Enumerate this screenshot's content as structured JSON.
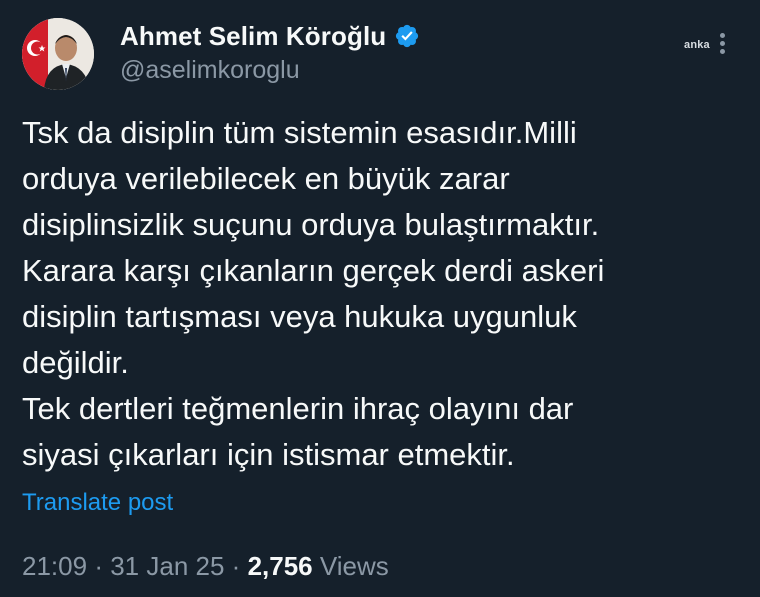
{
  "author": {
    "display_name": "Ahmet Selim Köroğlu",
    "handle": "@aselimkoroglu",
    "verified_icon": "verified-badge-icon",
    "verified_color": "#1d9bf0"
  },
  "watermark": "anka",
  "tweet": {
    "lines": [
      "Tsk da disiplin tüm sistemin esasıdır.Milli",
      "orduya verilebilecek en büyük zarar",
      "disiplinsizlik suçunu orduya bulaştırmaktır.",
      "Karara karşı çıkanların gerçek derdi askeri",
      "disiplin tartışması veya hukuka uygunluk",
      "değildir.",
      "Tek dertleri teğmenlerin ihraç olayını dar",
      "siyasi çıkarları için istismar etmektir."
    ]
  },
  "translate_label": "Translate post",
  "meta": {
    "time": "21:09",
    "separator": "·",
    "date": "31 Jan 25",
    "views_count": "2,756",
    "views_label": "Views"
  },
  "colors": {
    "background": "#15202b",
    "text": "#f7f9f9",
    "secondary": "#8b98a5",
    "link": "#1d9bf0"
  }
}
